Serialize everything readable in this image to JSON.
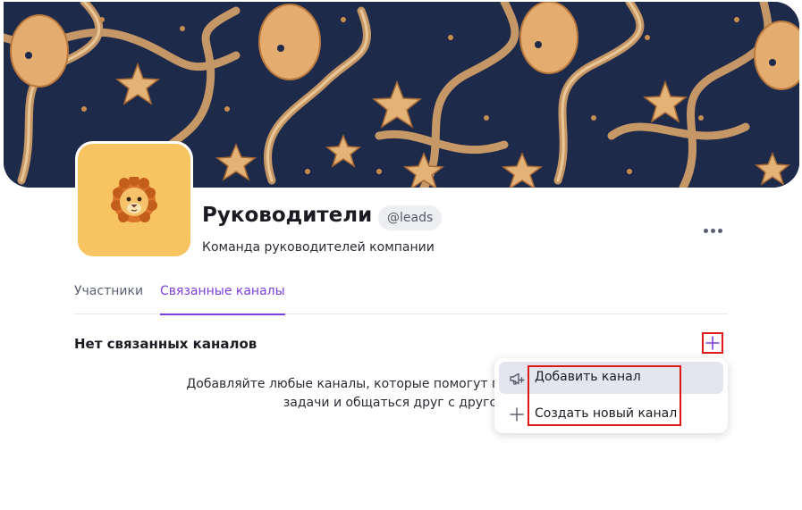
{
  "group": {
    "name": "Руководители",
    "handle": "@leads",
    "description": "Команда руководителей компании",
    "avatar": "lion-emoji-icon"
  },
  "tabs": [
    {
      "label": "Участники",
      "active": false
    },
    {
      "label": "Связанные каналы",
      "active": true
    }
  ],
  "channels_section": {
    "title": "Нет связанных каналов",
    "empty_line1": "Добавляйте любые каналы, которые помогут груп",
    "empty_line2": "задачи и общаться друг с другс"
  },
  "menu": {
    "items": [
      {
        "label": "Добавить канал",
        "icon": "megaphone-plus-icon"
      },
      {
        "label": "Создать новый канал",
        "icon": "plus-icon"
      }
    ]
  },
  "colors": {
    "accent": "#7b3fe0",
    "highlight": "#e01818",
    "avatar_bg": "#f8c462",
    "banner_bg": "#1e2a4a"
  }
}
